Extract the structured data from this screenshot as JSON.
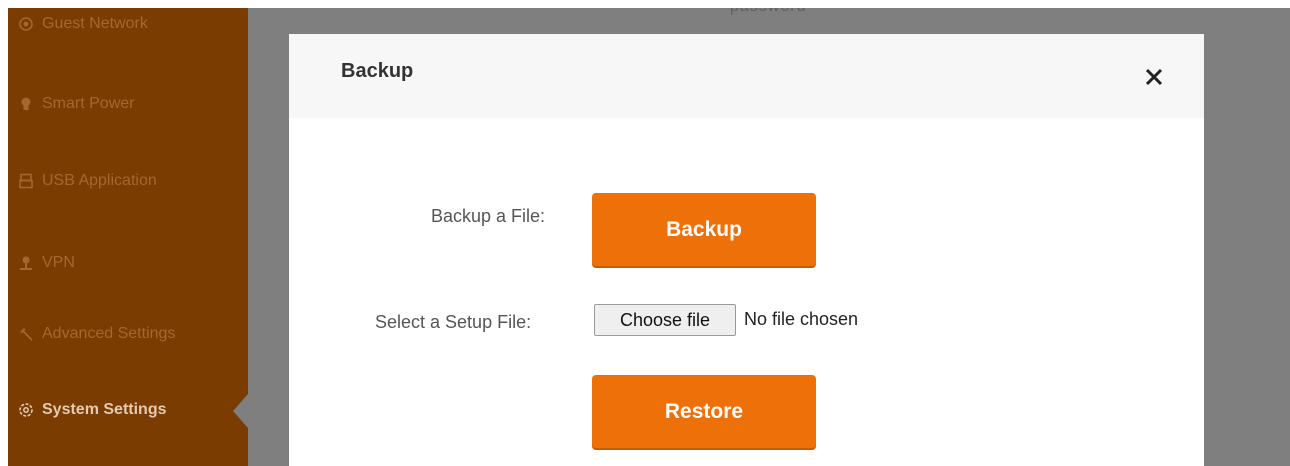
{
  "background": {
    "partial_text": "password"
  },
  "sidebar": {
    "items": [
      {
        "label": "Guest Network",
        "icon": "guest-network-icon",
        "active": false
      },
      {
        "label": "Smart Power",
        "icon": "bulb-icon",
        "active": false
      },
      {
        "label": "USB Application",
        "icon": "usb-icon",
        "active": false
      },
      {
        "label": "VPN",
        "icon": "vpn-icon",
        "active": false
      },
      {
        "label": "Advanced Settings",
        "icon": "wrench-icon",
        "active": false
      },
      {
        "label": "System Settings",
        "icon": "gear-icon",
        "active": true
      }
    ]
  },
  "modal": {
    "title": "Backup",
    "close_icon": "close-icon",
    "backup_label": "Backup a File:",
    "backup_button": "Backup",
    "setup_label": "Select a Setup File:",
    "choose_file_button": "Choose file",
    "no_file_text": "No file chosen",
    "restore_button": "Restore"
  },
  "colors": {
    "sidebar_bg": "#7a3c00",
    "sidebar_text": "#a5672e",
    "sidebar_active_text": "#e4cab2",
    "overlay": "#7f7f7f",
    "accent": "#ee7008",
    "modal_header_bg": "#f7f7f7"
  }
}
